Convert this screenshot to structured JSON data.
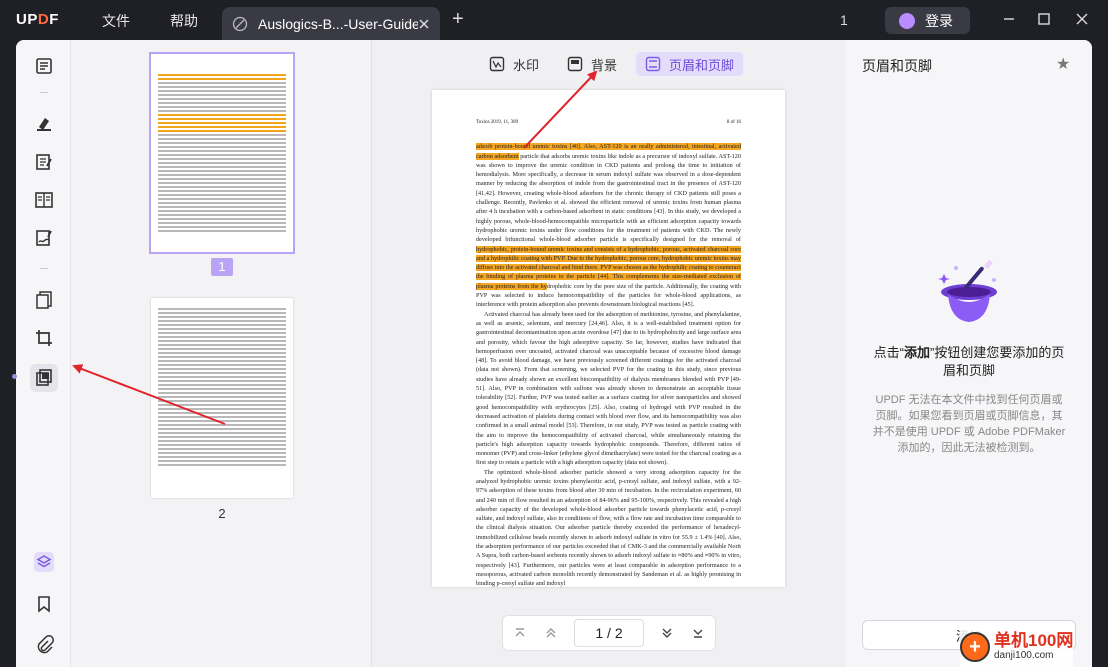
{
  "app": {
    "logo": "UPDF",
    "menu": [
      "文件",
      "帮助"
    ],
    "tab_title": "Auslogics-B...-User-Guide",
    "page_count": "1",
    "login": "登录"
  },
  "toolbar": {
    "tabs": [
      "水印",
      "背景",
      "页眉和页脚"
    ],
    "active_tab": "页眉和页脚"
  },
  "thumbnails": {
    "pages": [
      "1",
      "2"
    ],
    "selected": "1"
  },
  "document": {
    "header_left": "Toxins 2019, 11, 389",
    "header_right": "8 of 16",
    "paragraphs": [
      {
        "highlight": "adsorb protein-bound uremic toxins [40]. Also, AST-120 is an orally administered, intestinal, activated carbon adsorbent",
        "text": " particle that adsorbs uremic toxins like indole as a precursor of indoxyl sulfate. AST-120 was shown to improve the uremic condition in CKD patients and prolong the time to initiation of hemodialysis. More specifically, a decrease in serum indoxyl sulfate was observed in a dose-dependent manner by reducing the absorption of indole from the gastrointestinal tract in the presence of AST-120 [41,42]. However, creating whole-blood adsorbers for the chronic therapy of CKD patients still poses a challenge. Recently, Pavlenko et al. showed the efficient removal of uremic toxins from human plasma after 4 h incubation with a carbon-based adsorbent in static conditions [43]. In this study, we developed a highly porous, whole-blood-hemocompatible microparticle with an efficient adsorption capacity towards hydrophobic uremic toxins under flow conditions for the treatment of patients with CKD. The newly developed bifunctional whole-blood adsorber particle is specifically designed for the removal of ",
        "highlight2": "hydrophobic, protein-bound uremic toxins and consists of a hydrophobic, porous, activated charcoal core and a hydrophilic coating with PVP. Due to the hydrophobic, porous core, hydrophobic uremic toxins may diffuse into the activated charcoal and bind there. PVP was chosen as the hydrophilic coating to counteract the binding of plasma proteins to the particle [44]. This complements the size-mediated exclusion of plasma proteins from the hy",
        "text2": "drophobic core by the pore size of the particle. Additionally, the coating with PVP was selected to induce hemocompatibility of the particles for whole-blood applications, as interference with protein adsorption also prevents downstream biological reactions [45]."
      },
      {
        "text": "Activated charcoal has already been used for the adsorption of methionine, tyrosine, and phenylalanine, as well as arsenic, selenium, and mercury [24,46]. Also, it is a well-established treatment option for gastrointestinal decontamination upon acute overdose [47] due to its hydrophobicity and large surface area and porosity, which favour the high adsorptive capacity. So far, however, studies have indicated that hemoperfusion over uncoated, activated charcoal was unacceptable because of excessive blood damage [48]. To avoid blood damage, we have previously screened different coatings for the activated charcoal (data not shown). From that screening, we selected PVP for the coating in this study, since previous studies have already shown an excellent biocompatibility of dialysis membranes blended with PVP [49-51]. Also, PVP in combination with sulfone was already shown to demonstrate an acceptable tissue tolerability [52]. Further, PVP was tested earlier as a surface coating for silver nanoparticles and showed good hemocompatibility with erythrocytes [25]. Also, coating of hydrogel with PVP resulted in the decreased activation of platelets during contact with blood over flow, and its hemocompatibility was also confirmed in a small animal model [53]. Therefore, in our study, PVP was tested as particle coating with the aim to improve the hemocompatibility of activated charcoal, while simultaneously retaining the particle's high adsorption capacity towards hydrophobic compounds. Therefore, different ratios of monomer (PVP) and cross-linker (ethylene glycol dimethacrylate) were tested for the charcoal coating as a first step to retain a particle with a high adsorption capacity (data not shown)."
      },
      {
        "text": "The optimized whole-blood adsorber particle showed a very strong adsorption capacity for the analyzed hydrophobic uremic toxins phenylacetic acid, p-cresyl sulfate, and indoxyl sulfate, with a 92-97% adsorption of these toxins from blood after 30 min of incubation. In the recirculation experiment, 60 and 240 min of flow resulted in an adsorption of 84-96% and 95-100%, respectively. This revealed a high adsorber capacity of the developed whole-blood adsorber particle towards phenylacetic acid, p-cresyl sulfate, and indoxyl sulfate, also in conditions of flow, with a flow rate and incubation time comparable to the clinical dialysis situation. Our adsorber particle thereby exceeded the performance of hexadecyl-immobilized cellulose beads recently shown to adsorb indoxyl sulfate in vitro for 55.9 ± 1.4% [40]. Also, the adsorption performance of our particles exceeded that of CMK-3 and the commercially available Norit A Supra, both carbon-based sorbents recently shown to adsorb indoxyl sulfate to ≈80% and ≈90% in vitro, respectively [43]. Furthermore, our particles were at least comparable in adsorption performance to a mesoporous, activated carbon monolith recently demonstrated by Sandeman et al. as highly promising in binding p-cresyl sulfate and indoxyl"
      }
    ]
  },
  "pager": {
    "current": "1",
    "sep": "/",
    "total": "2"
  },
  "right_panel": {
    "title": "页眉和页脚",
    "main_prefix": "点击“",
    "main_bold": "添加",
    "main_suffix": "”按钮创建您要添加的页眉和页脚",
    "sub": "UPDF 无法在本文件中找到任何页眉或页脚。如果您看到页眉或页脚信息，其并不是使用 UPDF 或 Adobe PDFMaker 添加的，因此无法被检测到。",
    "add_button": "添加"
  },
  "watermark": {
    "site": "单机100网",
    "url": "danji100.com"
  },
  "colors": {
    "accent": "#7c5ce0",
    "highlight": "#f5a623",
    "titlebar": "#1f1f26",
    "annotation_arrow": "#e0242b"
  }
}
